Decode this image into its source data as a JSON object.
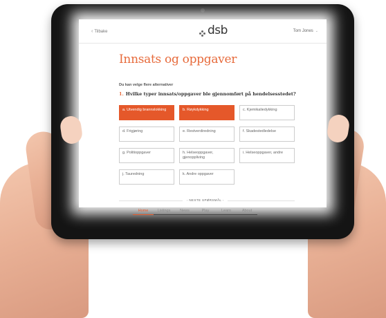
{
  "header": {
    "back_label": "Tilbake",
    "logo_text": "dsb",
    "user_name": "Tom Jones"
  },
  "page": {
    "title": "Innsats og oppgaver",
    "hint": "Du kan velge flere alternativer",
    "question_number": "1.",
    "question_text": "Hvilke typer innsats/oppgaver ble gjennomført på hendelsesstedet?"
  },
  "options": [
    {
      "label": "a. Utvendig brannslokking",
      "selected": true
    },
    {
      "label": "b. Røykdykking",
      "selected": true
    },
    {
      "label": "c. Kjemikaliedykking",
      "selected": false
    },
    {
      "label": "d. Frigjøring",
      "selected": false
    },
    {
      "label": "e. Restverdiredning",
      "selected": false
    },
    {
      "label": "f. Skadestedledelse",
      "selected": false
    },
    {
      "label": "g. Politioppgaver",
      "selected": false
    },
    {
      "label": "h. Helseoppgaver, gjenoppliving",
      "selected": false
    },
    {
      "label": "i. Helseoppgaver, andre",
      "selected": false
    },
    {
      "label": "j. Tauredning",
      "selected": false
    },
    {
      "label": "k. Andre oppgaver",
      "selected": false
    }
  ],
  "next_label": "NESTE SPØRSMÅL",
  "bottom_nav": [
    {
      "label": "Home",
      "active": true
    },
    {
      "label": "Listings",
      "active": false
    },
    {
      "label": "News",
      "active": false
    },
    {
      "label": "Play",
      "active": false
    },
    {
      "label": "Learn",
      "active": false
    },
    {
      "label": "About",
      "active": false
    }
  ],
  "colors": {
    "accent": "#e5582a",
    "title": "#e76b3c",
    "tablet_frame": "#141414"
  }
}
